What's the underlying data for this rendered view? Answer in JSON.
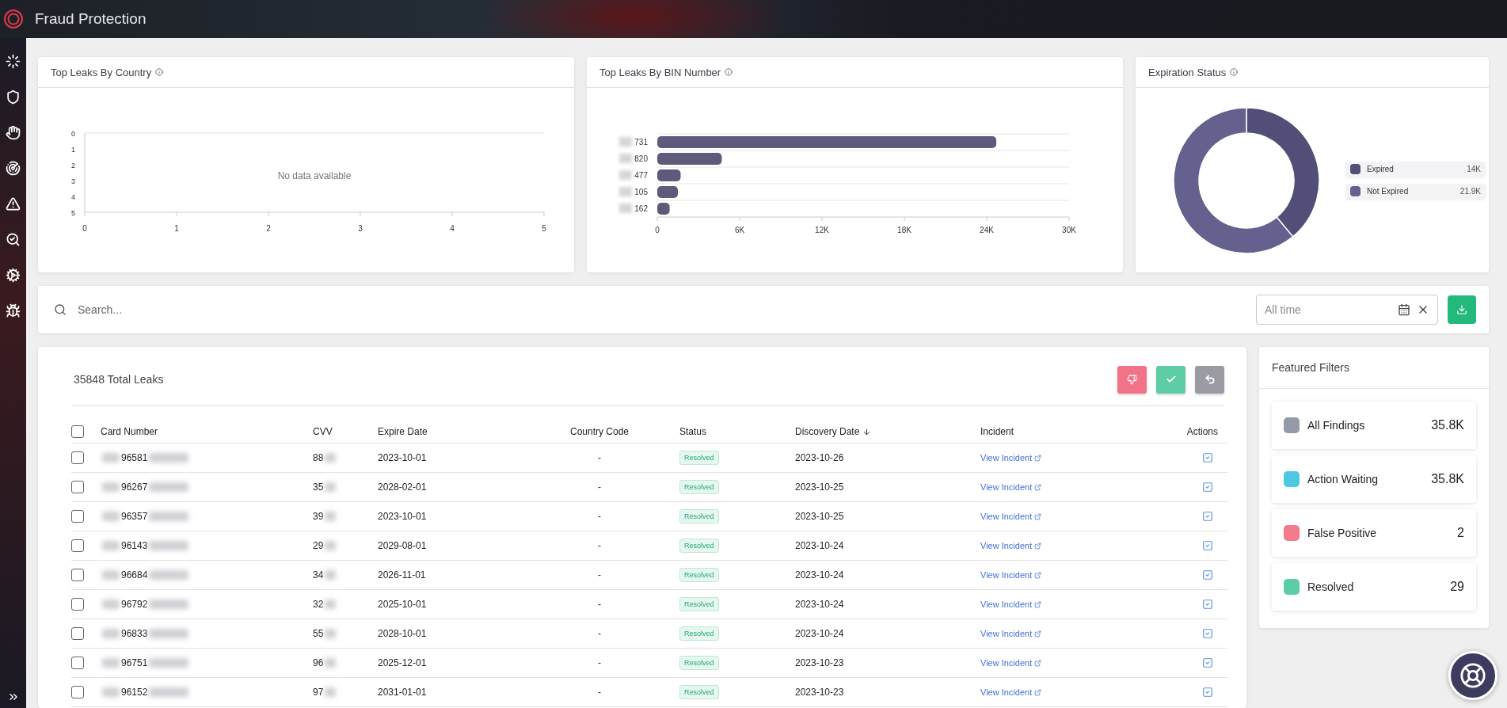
{
  "header": {
    "title": "Fraud Protection"
  },
  "charts": [
    {
      "title": "Top Leaks By Country",
      "chart_data": {
        "type": "bar",
        "xlim": [
          0,
          5
        ],
        "ylim": [
          5,
          0
        ],
        "xticks": [
          0,
          1,
          2,
          3,
          4,
          5
        ],
        "yticks": [
          0,
          1,
          2,
          3,
          4,
          5
        ],
        "annotations": [
          "No data available"
        ]
      }
    },
    {
      "title": "Top Leaks By BIN Number",
      "chart_data": {
        "type": "bar",
        "orientation": "horizontal",
        "categories": [
          "731",
          "820",
          "477",
          "105",
          "162"
        ],
        "values": [
          24700,
          4700,
          1700,
          1500,
          900
        ],
        "xlim": [
          0,
          30000
        ],
        "xticks": [
          {
            "value": 0,
            "label": "0"
          },
          {
            "value": 6000,
            "label": "6K"
          },
          {
            "value": 12000,
            "label": "12K"
          },
          {
            "value": 18000,
            "label": "18K"
          },
          {
            "value": 24000,
            "label": "24K"
          },
          {
            "value": 30000,
            "label": "30K"
          }
        ]
      }
    },
    {
      "title": "Expiration Status",
      "chart_data": {
        "type": "donut",
        "categories": [
          "Expired",
          "Not Expired"
        ],
        "values": [
          39,
          61
        ]
      },
      "legend": [
        {
          "value": "14K",
          "color": "#514f78"
        },
        {
          "value": "21.9K",
          "color": "#64618f"
        }
      ]
    }
  ],
  "search": {
    "placeholder": "Search...",
    "date_filter": "All time"
  },
  "table": {
    "total": "35848 Total Leaks",
    "select_all_checked": false,
    "columns": [
      "Card Number",
      "CVV",
      "Expire Date",
      "Country Code",
      "Status",
      "Discovery Date",
      "Incident",
      "Actions"
    ],
    "rows": [
      {
        "checked": false,
        "card": "96581",
        "cvv": "88",
        "expire": "2023-10-01",
        "country": "-",
        "status": "Resolved",
        "discovery": "2023-10-26",
        "incident": "View Incident"
      },
      {
        "checked": false,
        "card": "96267",
        "cvv": "35",
        "expire": "2028-02-01",
        "country": "-",
        "status": "Resolved",
        "discovery": "2023-10-25",
        "incident": "View Incident"
      },
      {
        "checked": false,
        "card": "96357",
        "cvv": "39",
        "expire": "2023-10-01",
        "country": "-",
        "status": "Resolved",
        "discovery": "2023-10-25",
        "incident": "View Incident"
      },
      {
        "checked": false,
        "card": "96143",
        "cvv": "29",
        "expire": "2029-08-01",
        "country": "-",
        "status": "Resolved",
        "discovery": "2023-10-24",
        "incident": "View Incident"
      },
      {
        "checked": false,
        "card": "96684",
        "cvv": "34",
        "expire": "2026-11-01",
        "country": "-",
        "status": "Resolved",
        "discovery": "2023-10-24",
        "incident": "View Incident"
      },
      {
        "checked": false,
        "card": "96792",
        "cvv": "32",
        "expire": "2025-10-01",
        "country": "-",
        "status": "Resolved",
        "discovery": "2023-10-24",
        "incident": "View Incident"
      },
      {
        "checked": false,
        "card": "96833",
        "cvv": "55",
        "expire": "2028-10-01",
        "country": "-",
        "status": "Resolved",
        "discovery": "2023-10-24",
        "incident": "View Incident"
      },
      {
        "checked": false,
        "card": "96751",
        "cvv": "96",
        "expire": "2025-12-01",
        "country": "-",
        "status": "Resolved",
        "discovery": "2023-10-23",
        "incident": "View Incident"
      },
      {
        "checked": false,
        "card": "96152",
        "cvv": "97",
        "expire": "2031-01-01",
        "country": "-",
        "status": "Resolved",
        "discovery": "2023-10-23",
        "incident": "View Incident"
      }
    ]
  },
  "filters": {
    "title": "Featured Filters",
    "items": [
      {
        "label": "All Findings",
        "count": "35.8K",
        "color": "#939aaa"
      },
      {
        "label": "Action Waiting",
        "count": "35.8K",
        "color": "#4ec8e2"
      },
      {
        "label": "False Positive",
        "count": "2",
        "color": "#f47a8d"
      },
      {
        "label": "Resolved",
        "count": "29",
        "color": "#5ccda5"
      }
    ]
  }
}
